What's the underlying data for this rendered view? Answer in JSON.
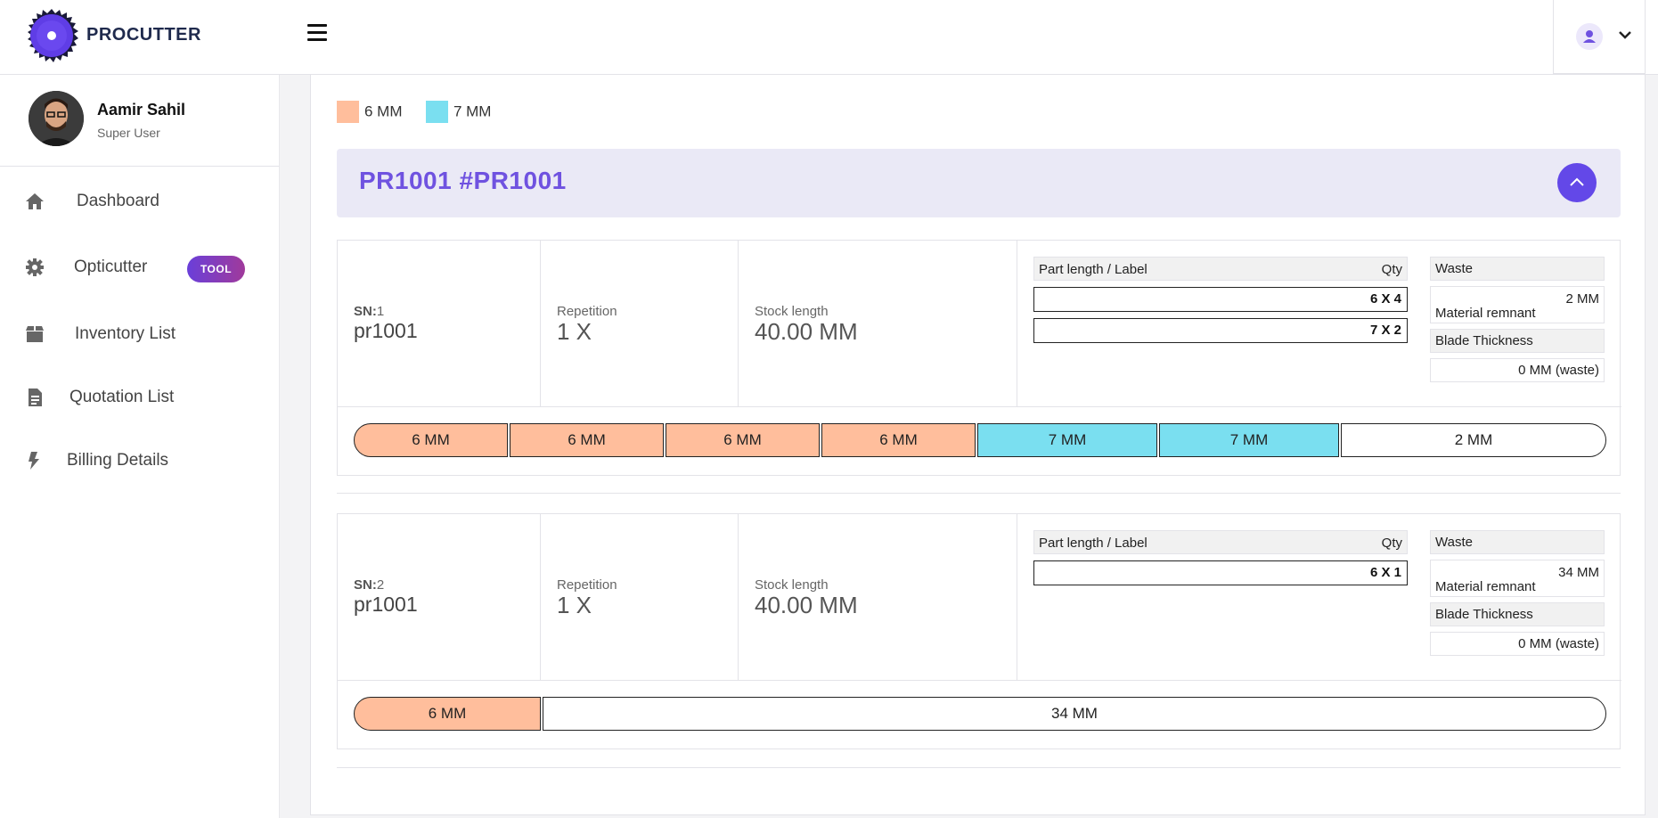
{
  "app": {
    "brand": "PROCUTTER"
  },
  "user": {
    "name": "Aamir Sahil",
    "role": "Super User"
  },
  "nav": [
    {
      "label": "Dashboard",
      "icon": "home-icon"
    },
    {
      "label": "Opticutter",
      "icon": "gear-icon",
      "badge": "TOOL"
    },
    {
      "label": "Inventory List",
      "icon": "box-icon"
    },
    {
      "label": "Quotation List",
      "icon": "document-icon"
    },
    {
      "label": "Billing Details",
      "icon": "bolt-icon"
    }
  ],
  "legend": [
    {
      "label": "6 MM",
      "color": "#ffbe9c"
    },
    {
      "label": "7 MM",
      "color": "#7adff0"
    }
  ],
  "project": {
    "title": "PR1001 #PR1001"
  },
  "labels": {
    "sn": "SN:",
    "repetition": "Repetition",
    "stock_length": "Stock length",
    "part_length": "Part length / Label",
    "qty": "Qty",
    "waste": "Waste",
    "material_remnant": "Material remnant",
    "blade_thickness": "Blade Thickness"
  },
  "results": [
    {
      "sn": "1",
      "name": "pr1001",
      "repetition": "1 X",
      "stock_length": "40.00 MM",
      "parts": [
        "6 X 4",
        "7 X 2"
      ],
      "remnant": "2 MM",
      "blade": "0 MM (waste)",
      "segments": [
        "6 MM",
        "6 MM",
        "6 MM",
        "6 MM",
        "7 MM",
        "7 MM",
        "2 MM"
      ]
    },
    {
      "sn": "2",
      "name": "pr1001",
      "repetition": "1 X",
      "stock_length": "40.00 MM",
      "parts": [
        "6 X 1"
      ],
      "remnant": "34 MM",
      "blade": "0 MM (waste)",
      "segments": [
        "6 MM",
        "34 MM"
      ]
    }
  ]
}
